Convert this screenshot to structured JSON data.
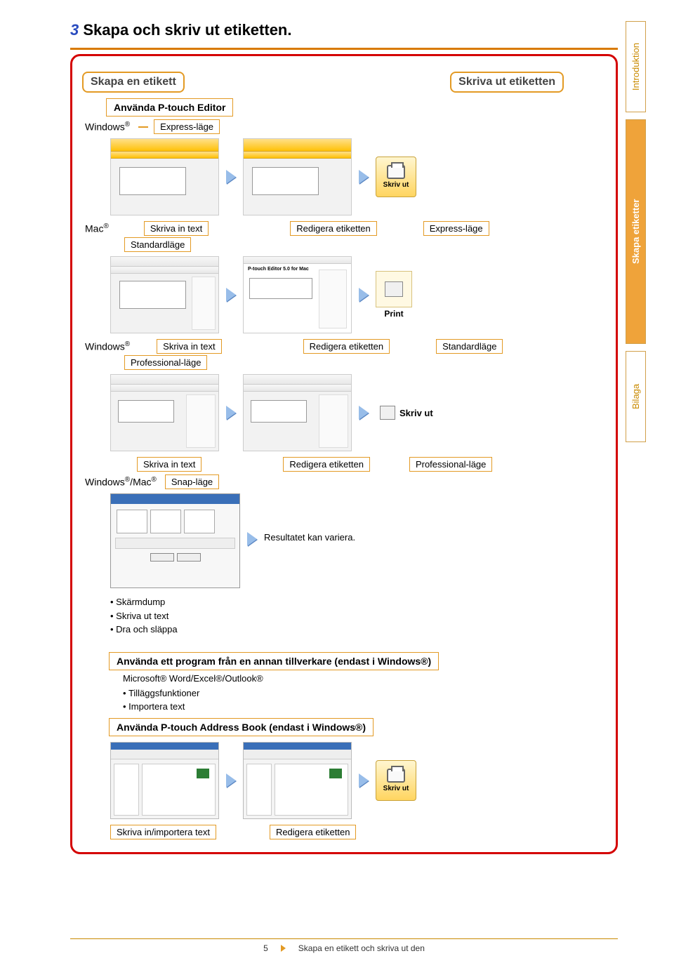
{
  "step_number": "3",
  "step_title": "Skapa och skriv ut etiketten.",
  "box1_title": "Skapa en etikett",
  "box1_sub": "Använda P-touch Editor",
  "box2_title": "Skriva ut etiketten",
  "os": {
    "windows": "Windows",
    "mac": "Mac",
    "winmac": "Windows®/Mac"
  },
  "reg": "®",
  "modes": {
    "express": "Express-läge",
    "standard": "Standardläge",
    "professional": "Professional-läge",
    "snap": "Snap-läge"
  },
  "labels": {
    "write_text": "Skriva in text",
    "edit_label": "Redigera etiketten",
    "result_vary": "Resultatet kan variera.",
    "write_import": "Skriva in/importera text"
  },
  "print_btn": {
    "skriv_ut": "Skriv ut",
    "print": "Print"
  },
  "bullets_snap": [
    "Skärmdump",
    "Skriva ut text",
    "Dra och släppa"
  ],
  "other_program_title": "Använda ett program från en annan tillverkare (endast i Windows®)",
  "other_program_sub": "Microsoft® Word/Excel®/Outlook®",
  "bullets_other": [
    "Tilläggsfunktioner",
    "Importera text"
  ],
  "address_book": "Använda P-touch Address Book (endast i Windows®)",
  "side_tabs": [
    "Introduktion",
    "Skapa etiketter",
    "Bilaga"
  ],
  "footer": {
    "page": "5",
    "text": "Skapa en etikett och skriva ut den"
  },
  "mac_dialog_title": "P-touch Editor 5.0 for Mac"
}
